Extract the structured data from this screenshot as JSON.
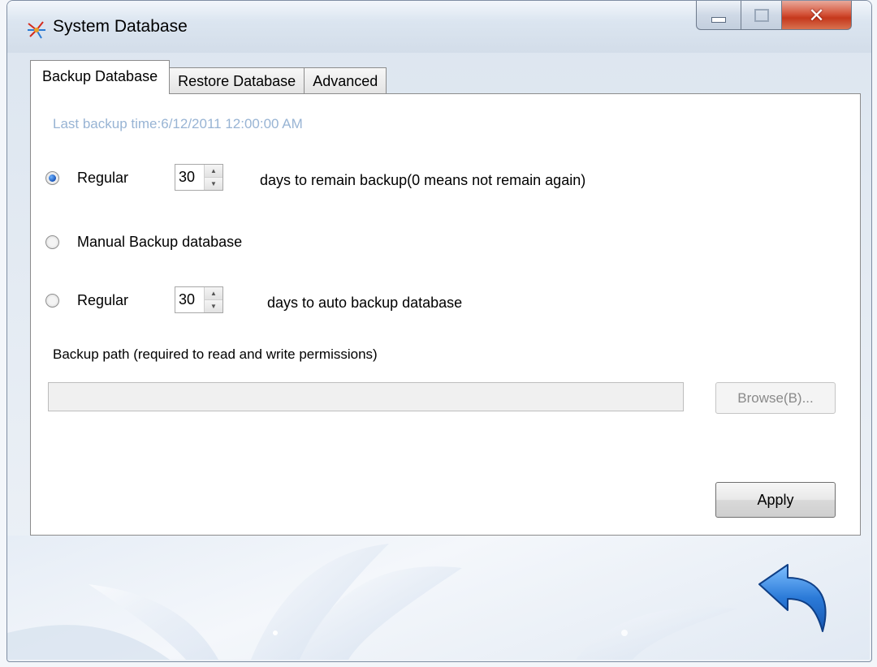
{
  "window": {
    "title": "System Database"
  },
  "tabs": [
    {
      "label": "Backup Database",
      "active": true
    },
    {
      "label": "Restore Database",
      "active": false
    },
    {
      "label": "Advanced",
      "active": false
    }
  ],
  "backup": {
    "last_backup": "Last backup time:6/12/2011 12:00:00 AM",
    "options": [
      {
        "label": "Regular",
        "checked": true,
        "spinner_value": "30",
        "suffix": "days to remain backup(0 means not remain again)"
      },
      {
        "label": "Manual Backup database",
        "checked": false
      },
      {
        "label": "Regular",
        "checked": false,
        "spinner_value": "30",
        "suffix": "days to auto backup database"
      }
    ],
    "path_label": "Backup path (required to read and write permissions)",
    "path_value": "",
    "browse_label": "Browse(B)...",
    "apply_label": "Apply"
  },
  "icons": {
    "app": "app-logo-icon",
    "back": "back-arrow-icon"
  },
  "colors": {
    "accent": "#1a55b8",
    "last_backup_text": "#98b4d4",
    "close_button": "#c5381c"
  }
}
